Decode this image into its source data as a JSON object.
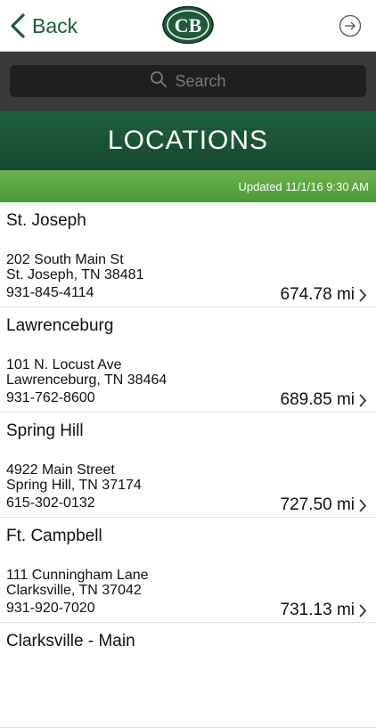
{
  "nav": {
    "back_label": "Back",
    "logo_text": "CB"
  },
  "search": {
    "placeholder": "Search"
  },
  "header": {
    "title": "LOCATIONS",
    "updated": "Updated 11/1/16 9:30 AM"
  },
  "locations": [
    {
      "name": "St. Joseph",
      "street": "202 South Main St",
      "city": "St. Joseph, TN 38481",
      "phone": "931-845-4114",
      "distance": "674.78 mi"
    },
    {
      "name": "Lawrenceburg",
      "street": "101 N. Locust Ave",
      "city": "Lawrenceburg, TN 38464",
      "phone": "931-762-8600",
      "distance": "689.85 mi"
    },
    {
      "name": "Spring Hill",
      "street": "4922 Main Street",
      "city": "Spring Hill, TN 37174",
      "phone": "615-302-0132",
      "distance": "727.50 mi"
    },
    {
      "name": "Ft. Campbell",
      "street": "111 Cunningham Lane",
      "city": "Clarksville, TN 37042",
      "phone": "931-920-7020",
      "distance": "731.13 mi"
    },
    {
      "name": "Clarksville - Main",
      "street": "",
      "city": "",
      "phone": "",
      "distance": ""
    }
  ]
}
